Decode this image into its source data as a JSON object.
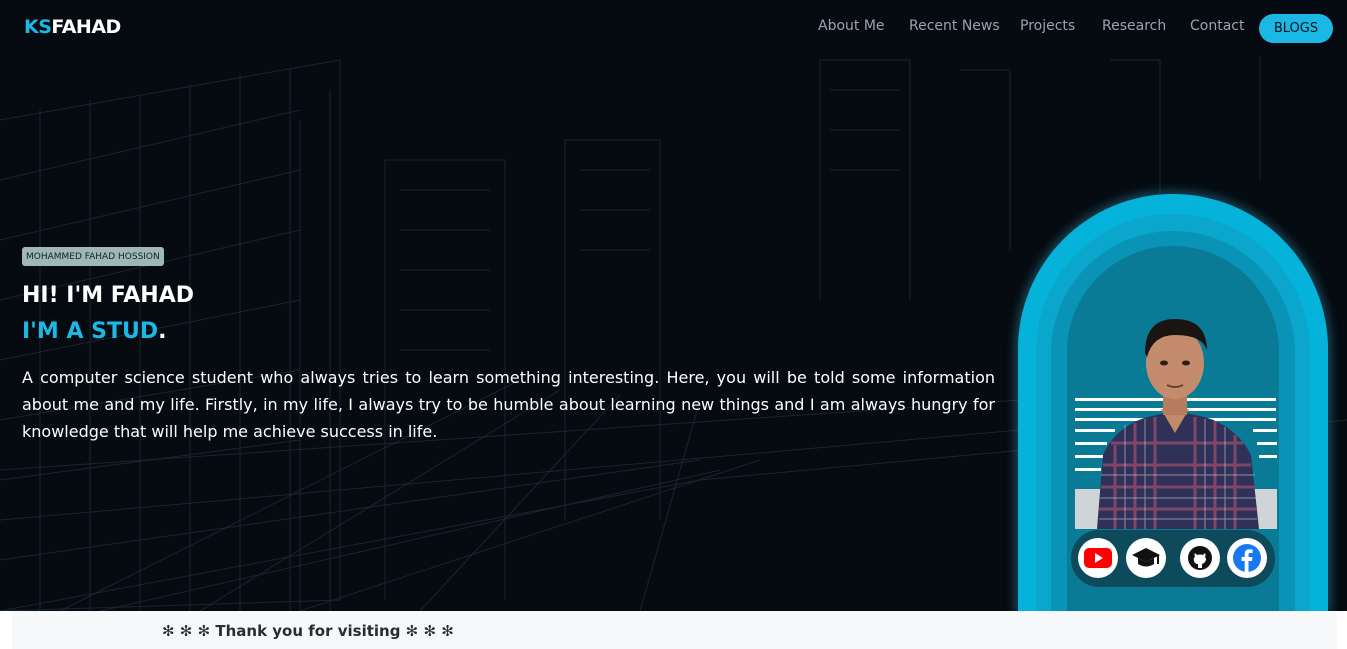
{
  "brand": {
    "prefix": "KS",
    "name": "FAHAD"
  },
  "nav": {
    "links": [
      "About Me",
      "Recent News",
      "Projects",
      "Research",
      "Contact"
    ],
    "blogs_button": "BLOGS"
  },
  "hero": {
    "badge": "MOHAMMED FAHAD HOSSION",
    "headline": "HI! I'M FAHAD",
    "typed_line": "I'M A STUD",
    "typed_suffix": ".",
    "bio": "A computer science student who always tries to learn something interesting. Here, you will be told some information about me and my life. Firstly, in my life, I always try to be humble about learning new things and I am always hungry for knowledge that will help me achieve success in life."
  },
  "profile": {
    "social_icons": [
      "youtube-icon",
      "graduation-cap-icon",
      "github-icon",
      "facebook-icon"
    ]
  },
  "footer": {
    "text": "✻ ✻ ✻ Thank you for visiting ✻ ✻ ✻"
  },
  "colors": {
    "accent": "#1bb8e6",
    "background": "#050b11",
    "arch_outer": "#05b3da",
    "arch_inner": "#0a7b96",
    "youtube": "#ff0000",
    "facebook": "#1877f2",
    "footer_bg": "#f6f8f9"
  }
}
